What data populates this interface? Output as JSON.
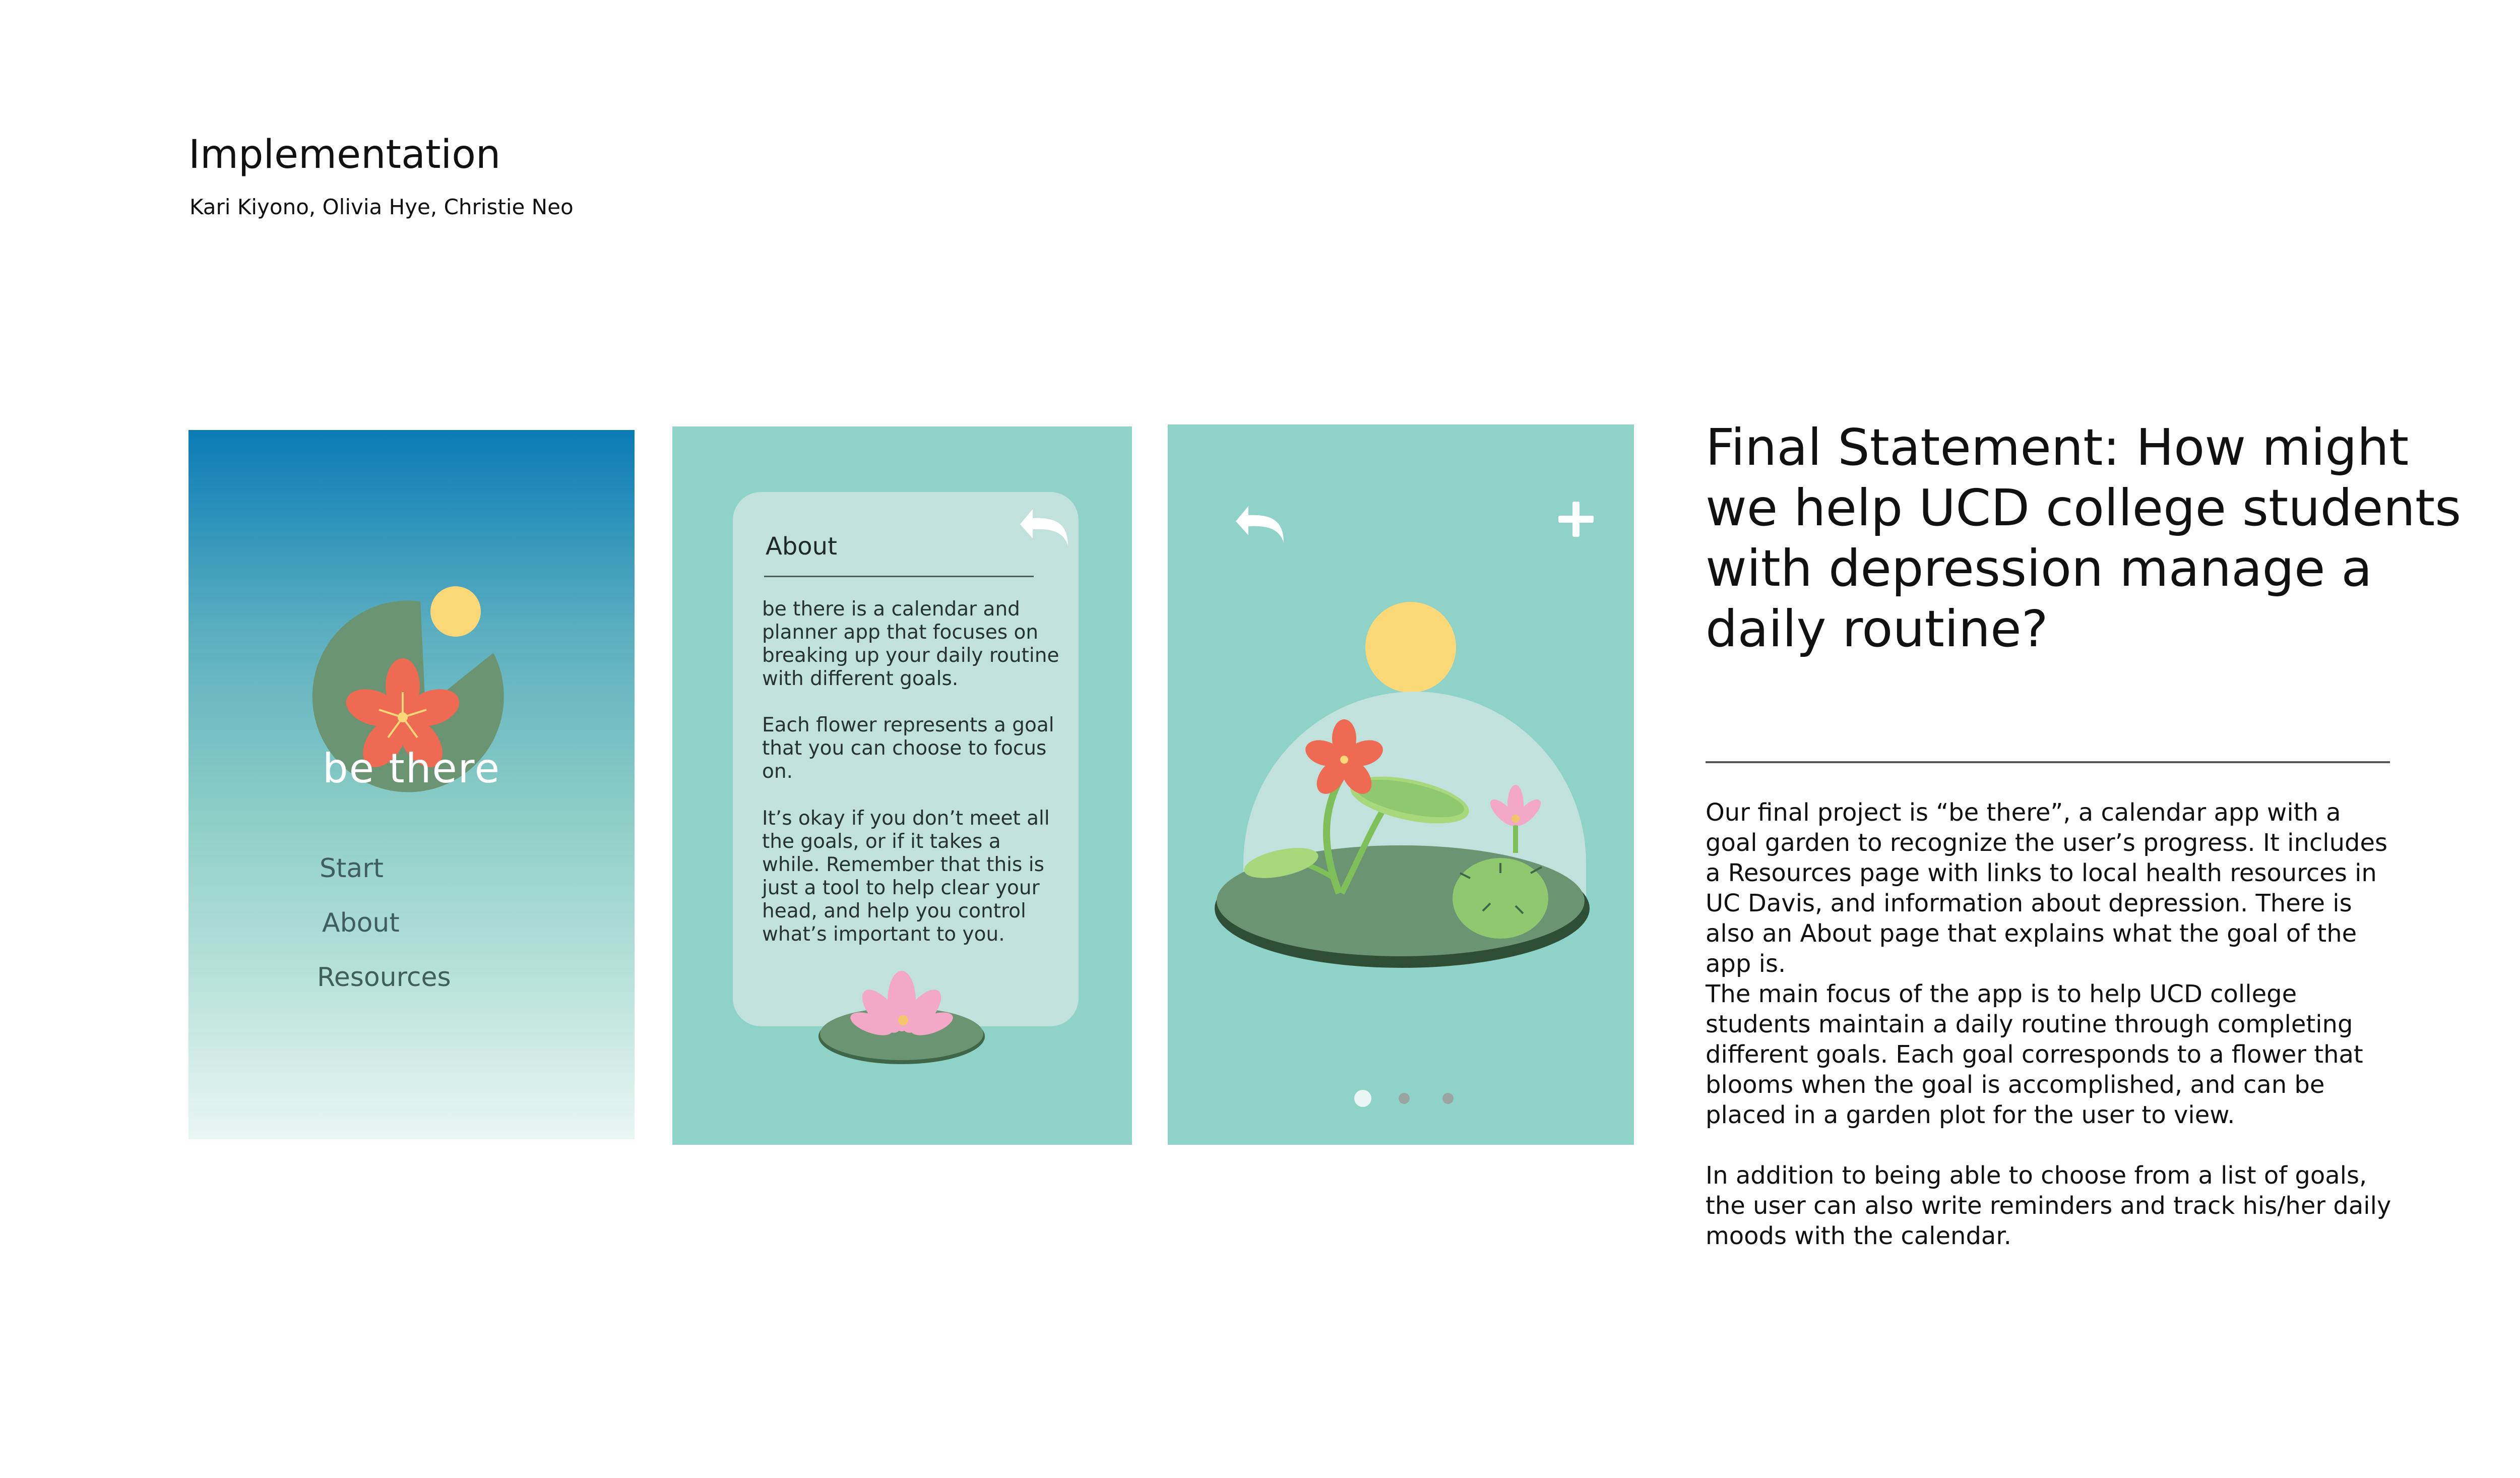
{
  "header": {
    "title": "Implementation",
    "authors": "Kari Kiyono, Olivia Hye, Christie Neo"
  },
  "start_screen": {
    "app_name": "be there",
    "menu": [
      "Start",
      "About",
      "Resources"
    ]
  },
  "about_screen": {
    "heading": "About",
    "paragraphs": [
      "be there is a calendar and planner app that focuses on breaking up your daily routine with different goals.",
      "Each flower represents a goal that you can choose to focus on.",
      "It’s okay if you don’t meet all the goals, or if it takes a while. Remember that this is just a tool to help clear your head, and help you control what’s important to you."
    ]
  },
  "garden_screen": {
    "pagination": {
      "active": 1,
      "total": 3
    }
  },
  "statement": {
    "title": "Final Statement: How might we help UCD college students with depression manage a daily routine?",
    "paragraphs": [
      "Our final project is “be there”, a calendar app with a goal garden to recognize the user’s progress. It includes a Resources page with links to local health resources in UC Davis, and information about depression. There is also an About page that explains what the goal of the app is.",
      "The main focus of the app is to help UCD college students maintain a daily routine through completing different goals. Each goal corresponds to a flower that blooms when the goal is accomplished, and can be placed in a garden plot for the user to view.",
      "In addition to being able to choose from a list of goals, the user can also write reminders and track his/her daily moods with the calendar."
    ]
  },
  "colors": {
    "teal_bg": "#8fd2c7",
    "card_bg": "#c1e1dc",
    "lily_pad": "#6b9472",
    "sun": "#fbd877",
    "flower_red": "#ee6a52",
    "lotus_pink": "#f2a8c6",
    "cactus_green": "#8fc86e"
  },
  "icons": [
    "back-arrow-icon",
    "plus-icon",
    "lily-pad-logo-icon",
    "lotus-icon",
    "sun-icon"
  ]
}
